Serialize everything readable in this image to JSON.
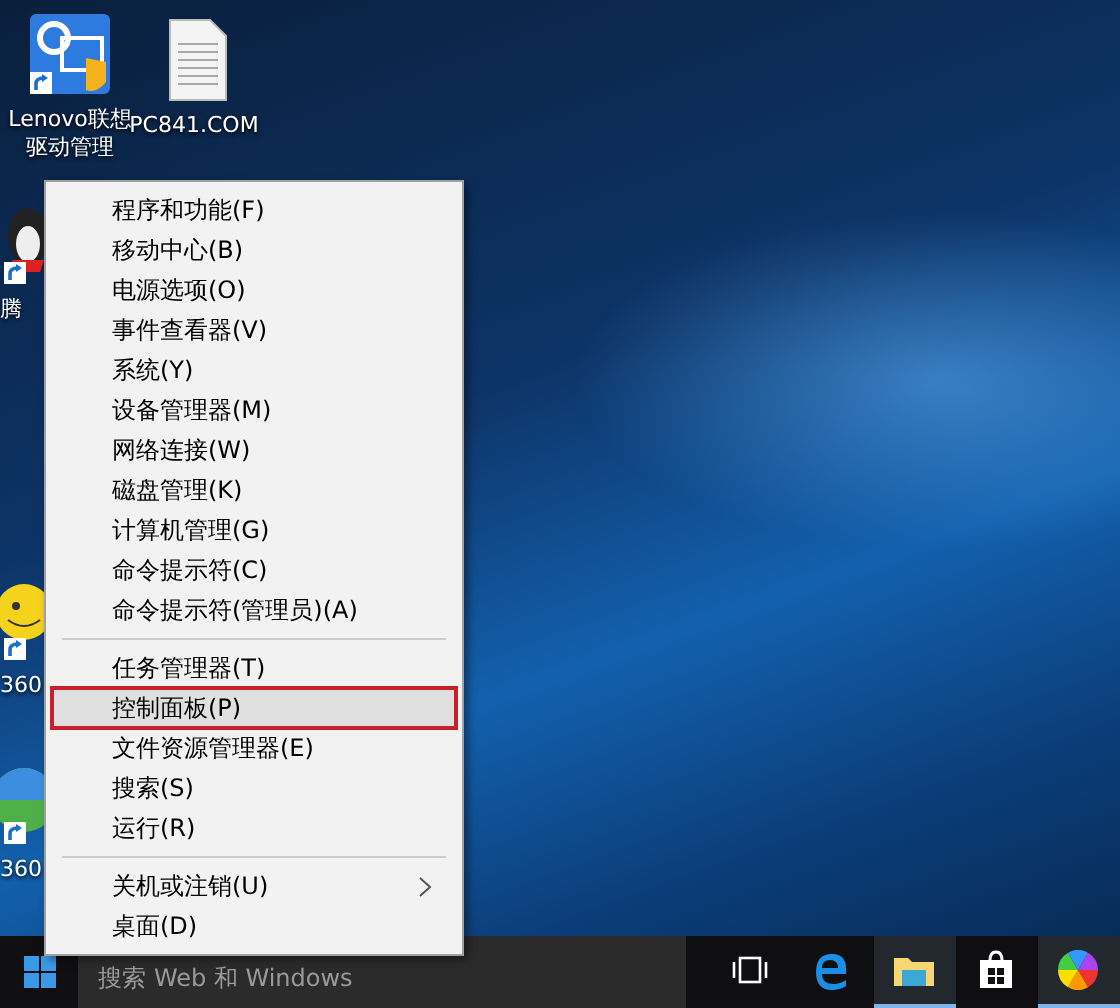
{
  "desktop_icons": [
    {
      "kind": "lenovo",
      "label": "Lenovo联想驱动管理",
      "shortcut": true
    },
    {
      "kind": "document",
      "label": "PC841.COM",
      "shortcut": false
    },
    {
      "kind": "penguin",
      "label": "腾",
      "shortcut": true
    },
    {
      "kind": "smiley",
      "label": "360",
      "shortcut": true
    },
    {
      "kind": "browser",
      "label": "360",
      "shortcut": true
    }
  ],
  "context_menu": {
    "groups": [
      [
        {
          "label": "程序和功能(F)",
          "selected": false,
          "submenu": false
        },
        {
          "label": "移动中心(B)",
          "selected": false,
          "submenu": false
        },
        {
          "label": "电源选项(O)",
          "selected": false,
          "submenu": false
        },
        {
          "label": "事件查看器(V)",
          "selected": false,
          "submenu": false
        },
        {
          "label": "系统(Y)",
          "selected": false,
          "submenu": false
        },
        {
          "label": "设备管理器(M)",
          "selected": false,
          "submenu": false
        },
        {
          "label": "网络连接(W)",
          "selected": false,
          "submenu": false
        },
        {
          "label": "磁盘管理(K)",
          "selected": false,
          "submenu": false
        },
        {
          "label": "计算机管理(G)",
          "selected": false,
          "submenu": false
        },
        {
          "label": "命令提示符(C)",
          "selected": false,
          "submenu": false
        },
        {
          "label": "命令提示符(管理员)(A)",
          "selected": false,
          "submenu": false
        }
      ],
      [
        {
          "label": "任务管理器(T)",
          "selected": false,
          "submenu": false
        },
        {
          "label": "控制面板(P)",
          "selected": true,
          "submenu": false
        },
        {
          "label": "文件资源管理器(E)",
          "selected": false,
          "submenu": false
        },
        {
          "label": "搜索(S)",
          "selected": false,
          "submenu": false
        },
        {
          "label": "运行(R)",
          "selected": false,
          "submenu": false
        }
      ],
      [
        {
          "label": "关机或注销(U)",
          "selected": false,
          "submenu": true
        },
        {
          "label": "桌面(D)",
          "selected": false,
          "submenu": false
        }
      ]
    ]
  },
  "taskbar": {
    "search": {
      "placeholder": "搜索 Web 和 Windows"
    },
    "pinned": [
      {
        "kind": "task-view",
        "running": false
      },
      {
        "kind": "edge",
        "running": false
      },
      {
        "kind": "explorer",
        "running": true
      },
      {
        "kind": "store",
        "running": false
      },
      {
        "kind": "colorful",
        "running": true
      }
    ]
  }
}
